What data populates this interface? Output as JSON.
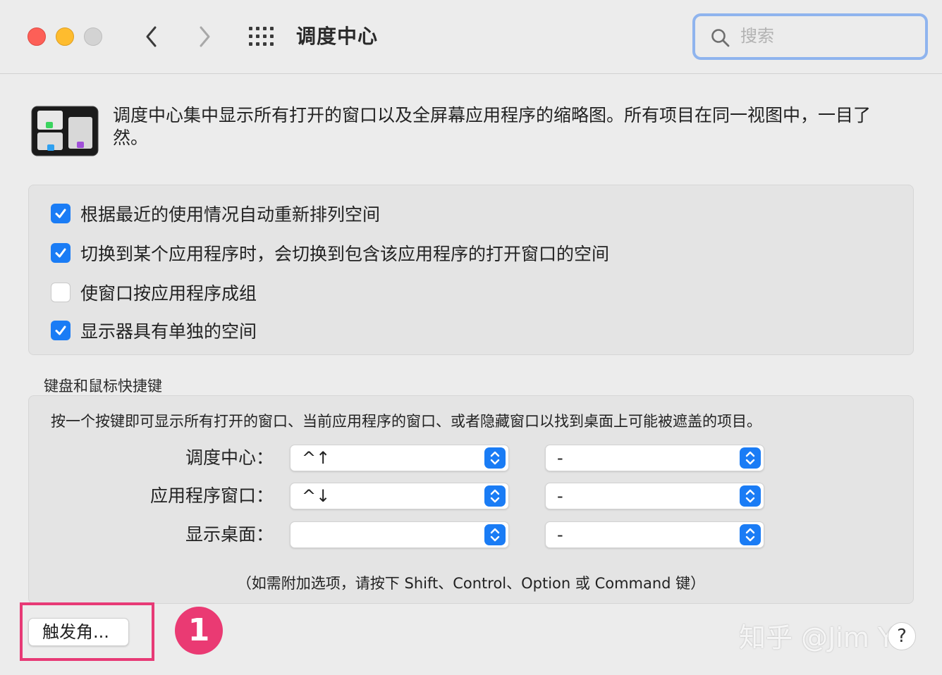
{
  "window": {
    "title": "调度中心",
    "search_placeholder": "搜索"
  },
  "header": {
    "description": "调度中心集中显示所有打开的窗口以及全屏幕应用程序的缩略图。所有项目在同一视图中，一目了然。"
  },
  "options": [
    {
      "label": "根据最近的使用情况自动重新排列空间",
      "checked": true
    },
    {
      "label": "切换到某个应用程序时，会切换到包含该应用程序的打开窗口的空间",
      "checked": true
    },
    {
      "label": "使窗口按应用程序成组",
      "checked": false
    },
    {
      "label": "显示器具有单独的空间",
      "checked": true
    }
  ],
  "shortcuts": {
    "section_title": "键盘和鼠标快捷键",
    "description": "按一个按键即可显示所有打开的窗口、当前应用程序的窗口、或者隐藏窗口以找到桌面上可能被遮盖的项目。",
    "rows": [
      {
        "label": "调度中心：",
        "keyboard": "^↑",
        "mouse": "-"
      },
      {
        "label": "应用程序窗口：",
        "keyboard": "^↓",
        "mouse": "-"
      },
      {
        "label": "显示桌面：",
        "keyboard": "",
        "mouse": "-"
      }
    ],
    "note": "（如需附加选项，请按下 Shift、Control、Option 或 Command 键）"
  },
  "footer": {
    "hot_corners_label": "触发角...",
    "help_label": "?"
  },
  "annotation": {
    "badge_number": "1",
    "highlight_color": "#e73a76"
  },
  "watermark": "知乎 @Jim Ye",
  "colors": {
    "accent": "#1a7cf5",
    "close": "#fd5f57",
    "minimize": "#febc2e"
  }
}
